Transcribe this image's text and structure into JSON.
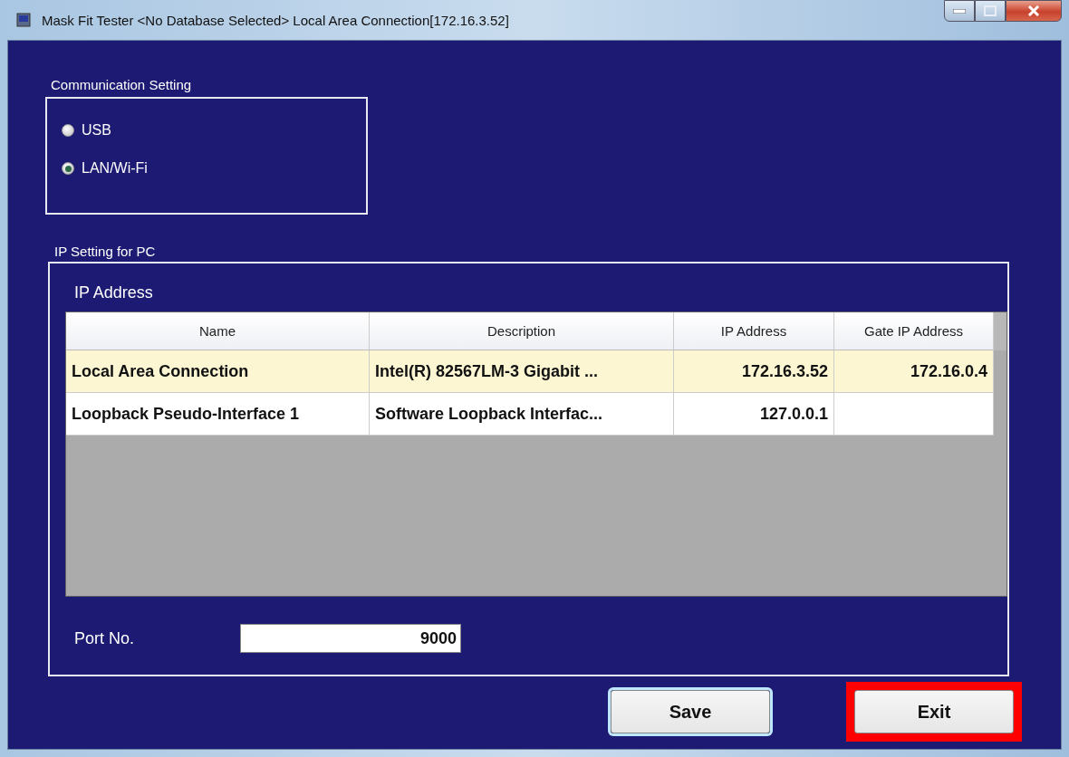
{
  "window": {
    "title": "Mask Fit Tester <No Database Selected> Local Area Connection[172.16.3.52]"
  },
  "communication_setting": {
    "label": "Communication Setting",
    "options": [
      {
        "label": "USB",
        "selected": false
      },
      {
        "label": "LAN/Wi-Fi",
        "selected": true
      }
    ]
  },
  "ip_setting": {
    "label": "IP Setting for PC",
    "ip_address_label": "IP Address",
    "table": {
      "columns": [
        "Name",
        "Description",
        "IP Address",
        "Gate IP Address"
      ],
      "rows": [
        {
          "cells": [
            "Local Area Connection",
            "Intel(R) 82567LM-3 Gigabit ...",
            "172.16.3.52",
            "172.16.0.4"
          ],
          "selected": true
        },
        {
          "cells": [
            "Loopback Pseudo-Interface 1",
            "Software Loopback Interfac...",
            "127.0.0.1"
          ],
          "selected": false
        }
      ]
    },
    "port": {
      "label": "Port No.",
      "value": "9000"
    }
  },
  "buttons": [
    {
      "label": "Save",
      "default": true,
      "highlighted": false
    },
    {
      "label": "Exit",
      "default": false,
      "highlighted": true
    }
  ]
}
